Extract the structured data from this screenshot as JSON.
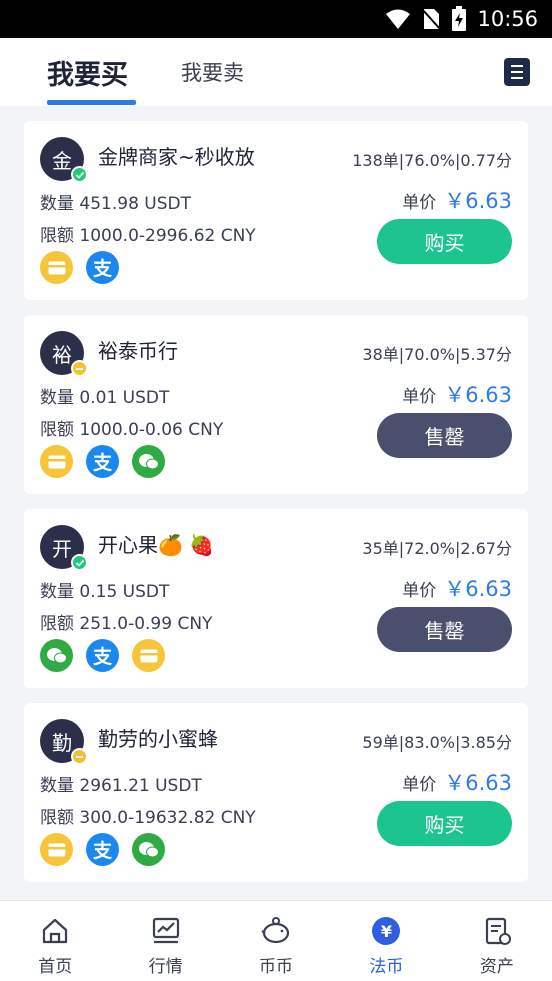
{
  "status_bar": {
    "time": "10:56"
  },
  "tabs": {
    "buy": "我要买",
    "sell": "我要卖"
  },
  "cards": [
    {
      "avatar_char": "金",
      "name": "金牌商家~秒收放",
      "stats": "138单|76.0%|0.77分",
      "qty": "数量 451.98 USDT",
      "limit": "限额 1000.0-2996.62 CNY",
      "price_label": "单价",
      "price": "￥6.63",
      "action": "购买"
    },
    {
      "avatar_char": "裕",
      "name": "裕泰币行",
      "stats": "38单|70.0%|5.37分",
      "qty": "数量 0.01 USDT",
      "limit": "限额 1000.0-0.06 CNY",
      "price_label": "单价",
      "price": "￥6.63",
      "action": "售罄"
    },
    {
      "avatar_char": "开",
      "name": "开心果🍊 🍓",
      "stats": "35单|72.0%|2.67分",
      "qty": "数量 0.15 USDT",
      "limit": "限额 251.0-0.99 CNY",
      "price_label": "单价",
      "price": "￥6.63",
      "action": "售罄"
    },
    {
      "avatar_char": "勤",
      "name": "勤劳的小蜜蜂",
      "stats": "59单|83.0%|3.85分",
      "qty": "数量 2961.21 USDT",
      "limit": "限额 300.0-19632.82 CNY",
      "price_label": "单价",
      "price": "￥6.63",
      "action": "购买"
    }
  ],
  "card_meta": [
    {
      "badge_icon": "check-badge-icon",
      "payments": [
        "bank-card-icon",
        "alipay-icon"
      ],
      "action_color": "#1cc58e"
    },
    {
      "badge_icon": "pending-badge-icon",
      "payments": [
        "bank-card-icon",
        "alipay-icon",
        "wechat-pay-icon"
      ],
      "action_color": "#4a4f6e"
    },
    {
      "badge_icon": "check-badge-icon",
      "payments": [
        "wechat-pay-icon",
        "alipay-icon",
        "bank-card-icon"
      ],
      "action_color": "#4a4f6e"
    },
    {
      "badge_icon": "pending-badge-icon",
      "payments": [
        "bank-card-icon",
        "alipay-icon",
        "wechat-pay-icon"
      ],
      "action_color": "#1cc58e"
    }
  ],
  "payment_glyph": {
    "alipay": "支"
  },
  "nav": {
    "home": "首页",
    "market": "行情",
    "coin": "币币",
    "fiat": "法币",
    "assets": "资产",
    "fiat_glyph": "¥"
  },
  "colors": {
    "accent": "#2f7be6",
    "buy": "#1cc58e",
    "sold_out": "#4a4f6e",
    "nav_active": "#2f5fe0"
  }
}
